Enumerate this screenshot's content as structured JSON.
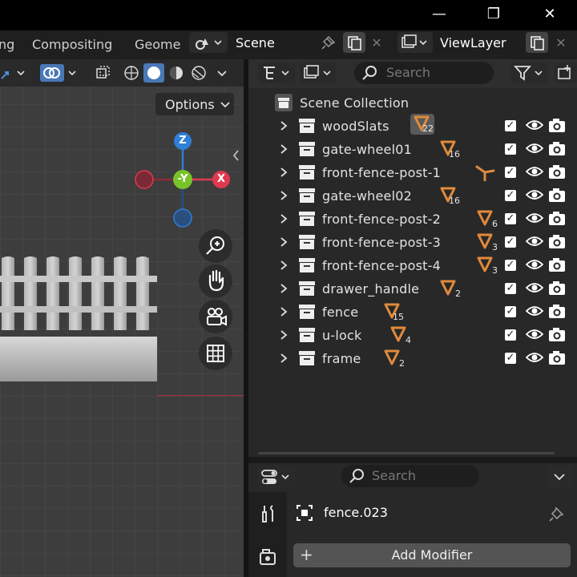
{
  "window": {
    "minimize": "—",
    "maximize": "❐",
    "close": "✕"
  },
  "header": {
    "tabs": [
      {
        "label": "ng"
      },
      {
        "label": "Compositing"
      },
      {
        "label": "Geome"
      }
    ],
    "scene_name": "Scene",
    "view_layer_name": "ViewLayer"
  },
  "viewport": {
    "options_label": "Options",
    "gizmo": {
      "z_label": "Z",
      "y_label": "-Y",
      "x_label": "X"
    }
  },
  "outliner": {
    "search_placeholder": "Search",
    "root_label": "Scene Collection",
    "items": [
      {
        "label": "woodSlats",
        "count": "22",
        "icon": "mesh-data-icon"
      },
      {
        "label": "gate-wheel01",
        "count": "16",
        "icon": "mesh-data-icon"
      },
      {
        "label": "front-fence-post-1",
        "count": "",
        "icon": "empty-axes-icon"
      },
      {
        "label": "gate-wheel02",
        "count": "16",
        "icon": "mesh-data-icon"
      },
      {
        "label": "front-fence-post-2",
        "count": "6",
        "icon": "mesh-data-icon"
      },
      {
        "label": "front-fence-post-3",
        "count": "3",
        "icon": "mesh-data-icon"
      },
      {
        "label": "front-fence-post-4",
        "count": "3",
        "icon": "mesh-data-icon"
      },
      {
        "label": "drawer_handle",
        "count": "2",
        "icon": "mesh-data-icon"
      },
      {
        "label": "fence",
        "count": "15",
        "icon": "mesh-data-icon"
      },
      {
        "label": "u-lock",
        "count": "4",
        "icon": "mesh-data-icon"
      },
      {
        "label": "frame",
        "count": "2",
        "icon": "mesh-data-icon"
      }
    ]
  },
  "properties": {
    "search_placeholder": "Search",
    "object_name": "fence.023",
    "add_modifier_label": "Add Modifier"
  },
  "colors": {
    "accent_orange": "#e08a3c",
    "axis_x": "#e0394f",
    "axis_y": "#79c32a",
    "axis_z": "#2f7fd6"
  }
}
